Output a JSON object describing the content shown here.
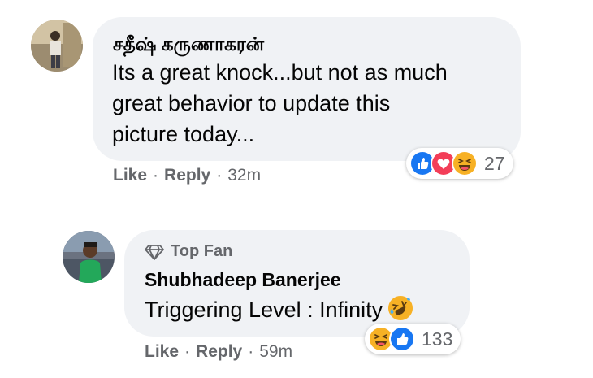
{
  "comments": [
    {
      "author": "சதீஷ் கருணாகரன்",
      "text_lines": [
        "Its a great knock...but not as much",
        "great behavior to update this",
        "picture today..."
      ],
      "actions": {
        "like": "Like",
        "reply": "Reply",
        "time": "32m"
      },
      "reactions": {
        "icons": [
          "like-icon",
          "love-icon",
          "haha-icon"
        ],
        "count": "27"
      }
    },
    {
      "badge": "Top Fan",
      "author": "Shubhadeep Banerjee",
      "text": "Triggering Level : Infinity",
      "actions": {
        "like": "Like",
        "reply": "Reply",
        "time": "59m"
      },
      "reactions": {
        "icons": [
          "haha-icon",
          "like-icon"
        ],
        "count": "133"
      }
    }
  ],
  "colors": {
    "bubble": "#f0f2f5",
    "text": "#050505",
    "secondary": "#65676b",
    "like_blue": "#1877f2",
    "love_red": "#f33e58",
    "haha_yellow": "#f7b125"
  }
}
